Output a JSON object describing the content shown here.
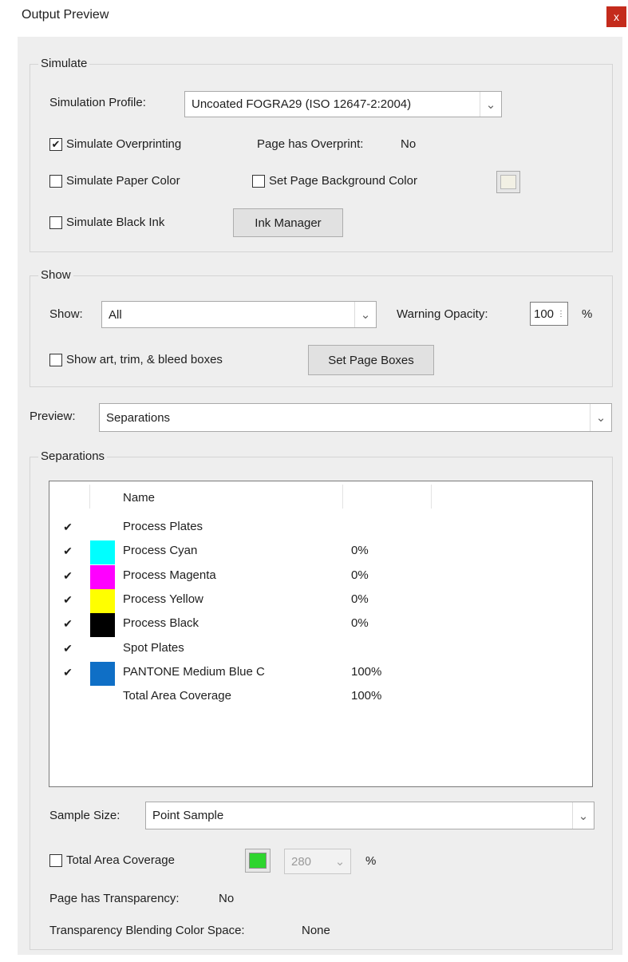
{
  "window": {
    "title": "Output Preview",
    "close_glyph": "x"
  },
  "simulate": {
    "legend": "Simulate",
    "profile_label": "Simulation Profile:",
    "profile_value": "Uncoated FOGRA29 (ISO 12647-2:2004)",
    "overprinting": {
      "label": "Simulate Overprinting",
      "checked": true
    },
    "page_overprint_label": "Page has Overprint:",
    "page_overprint_value": "No",
    "paper_color": {
      "label": "Simulate Paper Color",
      "checked": false
    },
    "page_bg_color": {
      "label": "Set Page Background Color",
      "checked": false
    },
    "black_ink": {
      "label": "Simulate Black Ink",
      "checked": false
    },
    "ink_manager_label": "Ink Manager"
  },
  "show": {
    "legend": "Show",
    "show_label": "Show:",
    "show_value": "All",
    "warning_opacity_label": "Warning Opacity:",
    "warning_opacity_value": "100",
    "percent": "%",
    "boxes": {
      "label": "Show art, trim, & bleed boxes",
      "checked": false
    },
    "set_page_boxes_label": "Set Page Boxes"
  },
  "preview": {
    "label": "Preview:",
    "value": "Separations"
  },
  "separations": {
    "legend": "Separations",
    "column_name": "Name",
    "rows": [
      {
        "checked": true,
        "swatch": null,
        "name": "Process Plates",
        "value": ""
      },
      {
        "checked": true,
        "swatch": "#00ffff",
        "name": "Process Cyan",
        "value": "0%"
      },
      {
        "checked": true,
        "swatch": "#ff00ff",
        "name": "Process Magenta",
        "value": "0%"
      },
      {
        "checked": true,
        "swatch": "#ffff00",
        "name": "Process Yellow",
        "value": "0%"
      },
      {
        "checked": true,
        "swatch": "#000000",
        "name": "Process Black",
        "value": "0%"
      },
      {
        "checked": true,
        "swatch": null,
        "name": "Spot Plates",
        "value": ""
      },
      {
        "checked": true,
        "swatch": "#0f6fc6",
        "name": "PANTONE Medium Blue C",
        "value": "100%"
      },
      {
        "checked": null,
        "swatch": null,
        "name": "Total Area Coverage",
        "value": "100%"
      }
    ],
    "sample_size_label": "Sample Size:",
    "sample_size_value": "Point Sample",
    "total_area": {
      "label": "Total Area Coverage",
      "checked": false
    },
    "coverage_color": "#2ed52e",
    "coverage_value": "280",
    "coverage_percent": "%",
    "transparency_label": "Page has Transparency:",
    "transparency_value": "No",
    "blending_label": "Transparency Blending Color Space:",
    "blending_value": "None"
  },
  "icons": {
    "check": "✔",
    "dropdown": "chevron-down-icon"
  }
}
